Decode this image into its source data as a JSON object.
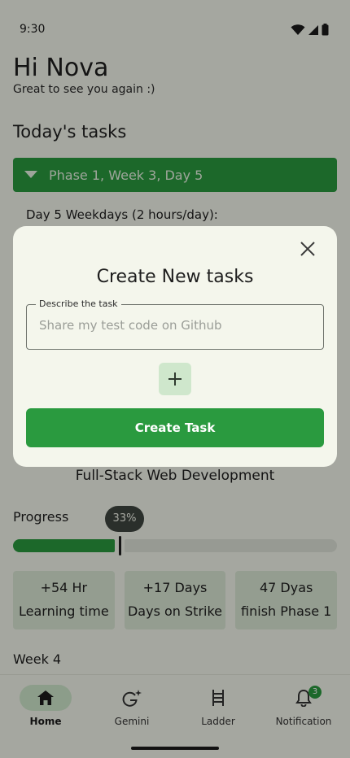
{
  "status_bar": {
    "time": "9:30"
  },
  "header": {
    "greeting": "Hi Nova",
    "subtitle": "Great to see you again :)"
  },
  "tasks": {
    "section_title": "Today's tasks",
    "phase_label": "Phase 1, Week 3, Day 5",
    "day_line": "Day 5 Weekdays (2 hours/day):"
  },
  "course": {
    "title": "Full-Stack Web Development"
  },
  "progress": {
    "label": "Progress",
    "badge": "33%",
    "fraction": 0.33
  },
  "stats": [
    {
      "value": "+54 Hr",
      "label": "Learning time"
    },
    {
      "value": "+17 Days",
      "label": "Days on Strike"
    },
    {
      "value": "47 Dyas",
      "label": "finish Phase 1"
    }
  ],
  "next_section": {
    "title": "Week 4"
  },
  "dialog": {
    "title": "Create New tasks",
    "field_label": "Describe the task",
    "field_placeholder": "Share my test code on Github",
    "field_value": "",
    "create_button": "Create Task"
  },
  "bottom_nav": {
    "items": [
      {
        "label": "Home",
        "icon": "home-icon",
        "active": true
      },
      {
        "label": "Gemini",
        "icon": "gemini-icon",
        "active": false
      },
      {
        "label": "Ladder",
        "icon": "ladder-icon",
        "active": false
      },
      {
        "label": "Notification",
        "icon": "bell-icon",
        "active": false,
        "badge": "3"
      }
    ]
  },
  "colors": {
    "accent": "#2a9a3f",
    "accent_light": "#cfe7cc",
    "background": "#f4f6ec",
    "stat_card": "#dbe7d5"
  }
}
